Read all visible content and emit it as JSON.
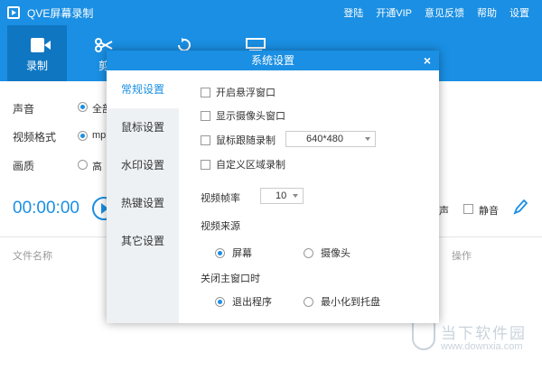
{
  "app": {
    "title": "QVE屏幕录制"
  },
  "top_menu": [
    "登陆",
    "开通VIP",
    "意见反馈",
    "帮助",
    "设置"
  ],
  "toolbar": {
    "record_label": "录制",
    "second_label": "剪"
  },
  "main": {
    "sound_label": "声音",
    "sound_value": "全部",
    "format_label": "视频格式",
    "format_value": "mp",
    "quality_label": "画质",
    "quality_value": "高",
    "timer": "00:00:00",
    "sound_partial": "声",
    "mute_label": "静音",
    "col_filename": "文件名称",
    "col_action": "操作"
  },
  "dialog": {
    "title": "系统设置",
    "close": "×",
    "side_items": [
      "常规设置",
      "鼠标设置",
      "水印设置",
      "热键设置",
      "其它设置"
    ],
    "options": {
      "float_window": "开启悬浮窗口",
      "show_camera": "显示摄像头窗口",
      "mouse_follow": "鼠标跟随录制",
      "mouse_follow_size": "640*480",
      "custom_area": "自定义区域录制",
      "fps_label": "视频帧率",
      "fps_value": "10",
      "source_label": "视频来源",
      "source_screen": "屏幕",
      "source_camera": "摄像头",
      "close_label": "关闭主窗口时",
      "exit_program": "退出程序",
      "minimize_tray": "最小化到托盘"
    }
  },
  "watermark": {
    "text": "当下软件园",
    "url": "www.downxia.com"
  }
}
